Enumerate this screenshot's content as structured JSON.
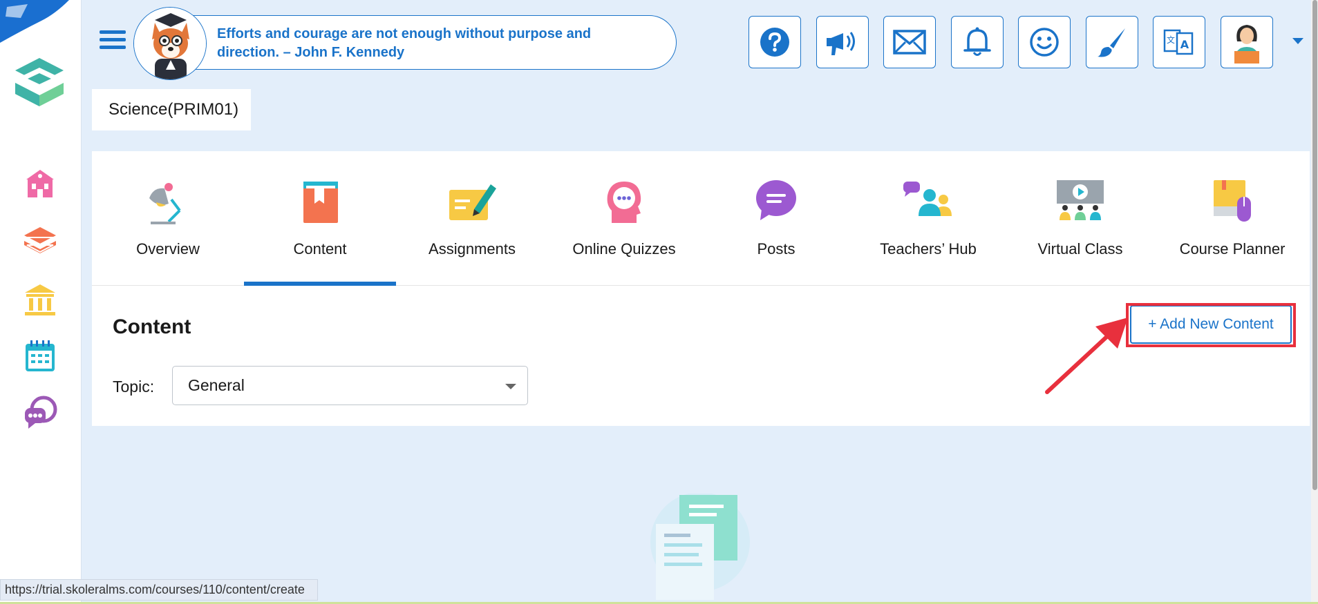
{
  "header": {
    "quote": "Efforts and courage are not enough without purpose and direction. – John F. Kennedy",
    "buttons": [
      "help-icon",
      "megaphone-icon",
      "mail-icon",
      "bell-icon",
      "smiley-icon",
      "brush-icon",
      "translate-icon",
      "user-avatar-icon"
    ]
  },
  "sidebar": {
    "items": [
      "school-icon",
      "books-icon",
      "institution-icon",
      "calendar-icon",
      "chat-support-icon"
    ]
  },
  "course": {
    "title": "Science(PRIM01)"
  },
  "tabs": [
    {
      "label": "Overview",
      "icon": "desk-lamp-icon"
    },
    {
      "label": "Content",
      "icon": "book-icon"
    },
    {
      "label": "Assignments",
      "icon": "pen-paper-icon"
    },
    {
      "label": "Online Quizzes",
      "icon": "quiz-head-icon"
    },
    {
      "label": "Posts",
      "icon": "speech-bubble-icon"
    },
    {
      "label": "Teachers’ Hub",
      "icon": "teachers-group-icon"
    },
    {
      "label": "Virtual Class",
      "icon": "video-class-icon"
    },
    {
      "label": "Course Planner",
      "icon": "planner-icon"
    }
  ],
  "active_tab": "Content",
  "content": {
    "title": "Content",
    "add_button": "+ Add New Content",
    "topic_label": "Topic:",
    "topic_value": "General"
  },
  "status_bar": {
    "url": "https://trial.skoleralms.com/courses/110/content/create"
  },
  "colors": {
    "accent": "#1a73c9",
    "highlight": "#e8303d",
    "background": "#e3eefa"
  }
}
